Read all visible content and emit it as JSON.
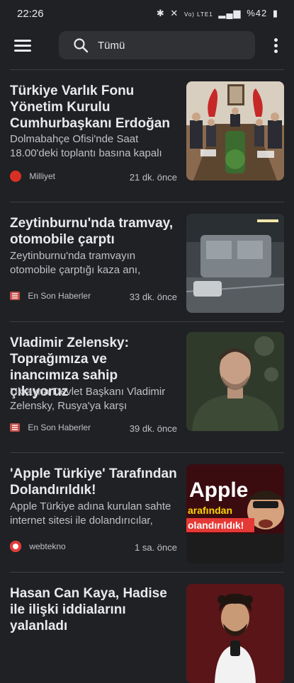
{
  "status_bar": {
    "time": "22:26",
    "icons": [
      "bluetooth-icon",
      "mute-icon",
      "wifi-icon",
      "signal-icon",
      "battery-icon"
    ],
    "battery": "%42",
    "network": "Vo) LTE1"
  },
  "top_bar": {
    "search_value": "Tümü"
  },
  "articles": [
    {
      "title": "Türkiye Varlık Fonu Yönetim Kurulu Cumhurbaşkanı Erdoğan",
      "snippet": "Dolmabahçe Ofisi'nde Saat 18.00'deki toplantı basına kapalı",
      "source": "Milliyet",
      "time": "21 dk. önce"
    },
    {
      "title": "Zeytinburnu'nda tramvay, otomobile çarptı",
      "snippet": "Zeytinburnu'nda tramvayın otomobile çarptığı kaza anı,",
      "source": "En Son Haberler",
      "time": "33 dk. önce"
    },
    {
      "title": "Vladimir Zelensky: Toprağımıza ve inancımıza sahip çıkıyoruz",
      "snippet": "Ukrayna Devlet Başkanı Vladimir Zelensky, Rusya'ya karşı",
      "source": "En Son Haberler",
      "time": "39 dk. önce"
    },
    {
      "title": "'Apple Türkiye' Tarafından Dolandırıldık!",
      "snippet": "Apple Türkiye adına kurulan sahte internet sitesi ile dolandırıcılar,",
      "source": "webtekno",
      "time": "1 sa. önce",
      "thumb_text": [
        "Apple",
        "arafından",
        "olandırıldık!"
      ]
    },
    {
      "title": "Hasan Can Kaya, Hadise ile ilişki iddialarını yalanladı"
    }
  ]
}
